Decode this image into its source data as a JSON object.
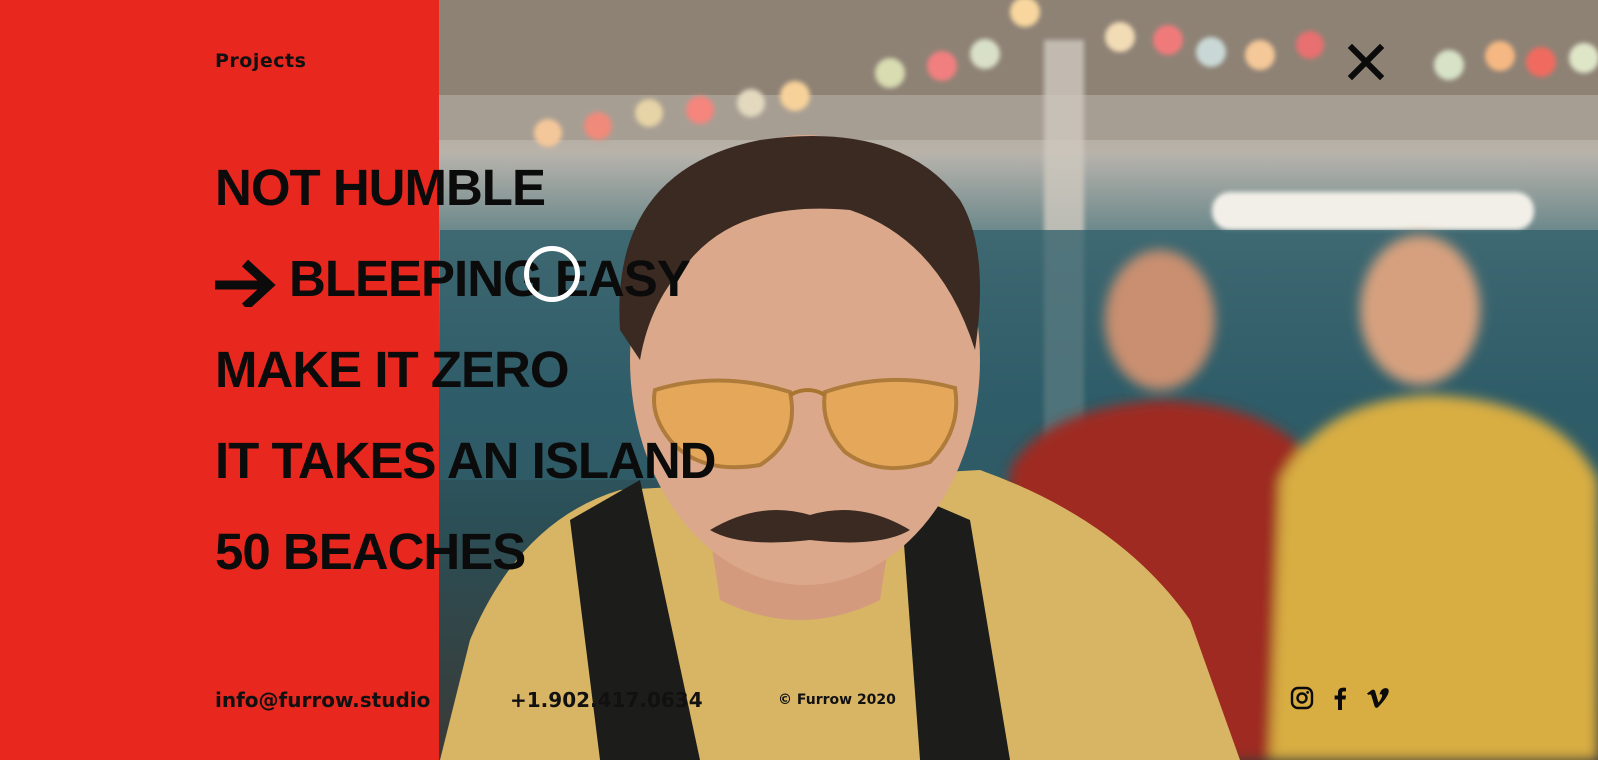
{
  "header": {
    "section_title": "Projects"
  },
  "projects": [
    {
      "label": "NOT HUMBLE",
      "active": false
    },
    {
      "label": "BLEEPING EASY",
      "active": true
    },
    {
      "label": "MAKE IT ZERO",
      "active": false
    },
    {
      "label": "IT TAKES AN ISLAND",
      "active": false
    },
    {
      "label": "50 BEACHES",
      "active": false
    }
  ],
  "footer": {
    "email": "info@furrow.studio",
    "phone": "+1.902.417.0634",
    "copyright": "© Furrow 2020"
  },
  "socials": [
    "instagram-icon",
    "facebook-icon",
    "vimeo-icon"
  ],
  "icons": {
    "close": "close-icon",
    "active_marker": "arrow-right-icon"
  },
  "colors": {
    "accent_red": "#e8271f",
    "text": "#0b0b0b",
    "cursor_ring": "#ffffff"
  }
}
